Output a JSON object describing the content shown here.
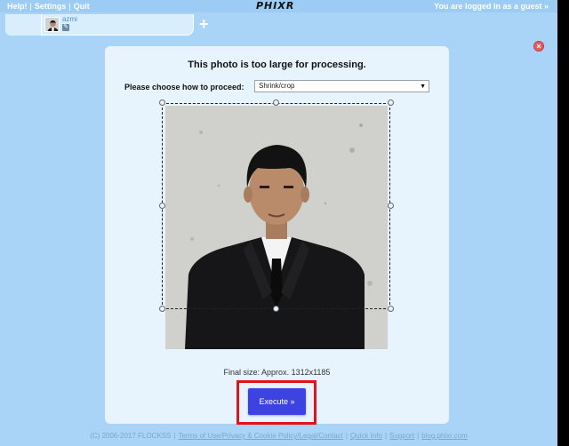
{
  "topbar": {
    "links": [
      "Help!",
      "Settings",
      "Quit"
    ],
    "logo": "PHIXR",
    "login_info": "You are logged in as a guest »"
  },
  "tabs": {
    "active_tab_name": "azmi",
    "add_label": "+"
  },
  "dialog": {
    "title": "This photo is too large for processing.",
    "choose_label": "Please choose how to proceed:",
    "select_value": "Shrink/crop",
    "final_size": "Final size: Approx. 1312x1185",
    "execute_label": "Execute »"
  },
  "footer": {
    "copyright": "(C) 2006-2017 FLOCKSS",
    "links": [
      "Terms of Use/Privacy & Cookie Policy/Legal/Contact",
      "Quick Info",
      "Support",
      "blog.phixr.com"
    ]
  },
  "icons": {
    "close": "close-icon",
    "add": "plus-icon",
    "dropdown": "chevron-down-icon"
  },
  "colors": {
    "background": "#a9d3f7",
    "dialog": "#e7f3fd",
    "execute": "#3d43e0",
    "highlight": "#e0141a"
  }
}
